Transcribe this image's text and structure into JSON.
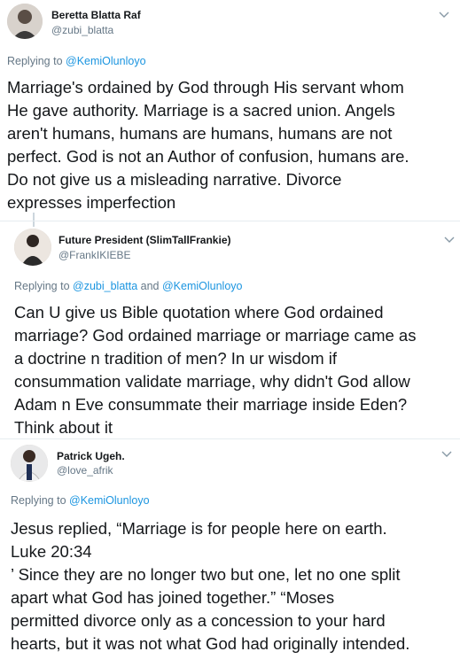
{
  "tweets": [
    {
      "name": "Beretta Blatta Raf",
      "handle": "@zubi_blatta",
      "replying_prefix": "Replying to ",
      "replying_to": [
        "@KemiOlunloyo"
      ],
      "text": "Marriage's ordained by God through His servant whom\nHe gave authority. Marriage is a sacred union. Angels\naren't humans, humans are humans, humans are not\nperfect. God is not an Author of confusion, humans are.\nDo not give us a misleading narrative. Divorce\nexpresses imperfection"
    },
    {
      "name": "Future President (SlimTallFrankie)",
      "handle": "@FrankIKIEBE",
      "replying_prefix": "Replying to ",
      "replying_to": [
        "@zubi_blatta",
        "@KemiOlunloyo"
      ],
      "replying_joiner": " and ",
      "text": "Can U give us Bible quotation where God ordained\nmarriage? God ordained marriage or marriage came as\na doctrine n tradition of men? In ur wisdom if\nconsummation validate marriage, why didn't God allow\nAdam n Eve consummate their marriage inside Eden?\nThink about it"
    },
    {
      "name": "Patrick Ugeh.",
      "handle": "@love_afrik",
      "replying_prefix": "Replying to ",
      "replying_to": [
        "@KemiOlunloyo"
      ],
      "text": "Jesus replied, “Marriage is for people here on earth.\nLuke 20:34\n’  Since they are no longer two but one, let no one split\napart what God has joined together.”  “Moses\npermitted divorce only as a concession to your hard\nhearts, but it was not what God had originally intended."
    }
  ],
  "icons": {
    "more": "chevron-down-icon"
  },
  "colors": {
    "link": "#1b95e0",
    "secondary_text": "#657786",
    "primary_text": "#14171a",
    "divider": "#e6ecf0"
  }
}
